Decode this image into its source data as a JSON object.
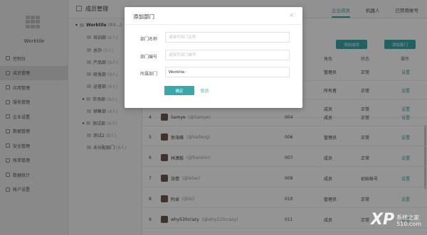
{
  "app": {
    "brand": "Worktile",
    "header_title": "成员管理",
    "tabs": [
      "企业成员",
      "机器人",
      "已禁用帐号"
    ]
  },
  "sidebar": {
    "items": [
      {
        "label": "控制台",
        "icon": "dashboard-icon"
      },
      {
        "label": "成员管理",
        "icon": "members-icon",
        "active": true
      },
      {
        "label": "应用管理",
        "icon": "apps-icon"
      },
      {
        "label": "服务管理",
        "icon": "service-icon"
      },
      {
        "label": "企业设置",
        "icon": "settings-icon"
      },
      {
        "label": "数据管理",
        "icon": "data-icon"
      },
      {
        "label": "安全管理",
        "icon": "security-icon"
      },
      {
        "label": "账单管理",
        "icon": "billing-icon"
      },
      {
        "label": "数据统计",
        "icon": "stats-icon"
      },
      {
        "label": "帐户设置",
        "icon": "account-icon"
      }
    ]
  },
  "tree": {
    "root": {
      "label": "Worktile",
      "count": "(83…)"
    },
    "items": [
      {
        "label": "培训部",
        "count": "(6人)"
      },
      {
        "label": "总办",
        "count": "(5人)"
      },
      {
        "label": "产品部",
        "count": "(9人)"
      },
      {
        "label": "研发部",
        "count": "(9人)"
      },
      {
        "label": "运营部",
        "count": "(6人)"
      },
      {
        "label": "市场部",
        "count": "(9人)"
      },
      {
        "label": "销售部",
        "count": "(4人)"
      },
      {
        "label": "测试部",
        "count": "(6人)"
      },
      {
        "label": "测试2",
        "count": "(8人)"
      },
      {
        "label": "未分配部门",
        "count": "(8人)"
      }
    ]
  },
  "toolbar": {
    "add_member": "添加成员",
    "add_dept": "添加部门"
  },
  "table": {
    "headers": {
      "role": "角色",
      "status": "状态",
      "action": "操作"
    },
    "top_rows": [
      {
        "role": "管理员",
        "status": "正常",
        "action": "设置"
      },
      {
        "role": "所有者",
        "status": "正常",
        "action": "设置"
      },
      {
        "role": "成员",
        "status": "正常",
        "action": "设置"
      }
    ],
    "rows": [
      {
        "no": "4",
        "name": "Samye",
        "handle": "(@Samye)",
        "code": "004",
        "role": "成员",
        "status": "正常",
        "action": "设置"
      },
      {
        "no": "5",
        "name": "徐海峰",
        "handle": "(@haifeng)",
        "code": "006",
        "role": "管理员",
        "status": "正常",
        "action": "设置"
      },
      {
        "no": "6",
        "name": "林潇毅",
        "handle": "(@franklin)",
        "code": "007",
        "role": "成员",
        "status": "正常",
        "action": "设置"
      },
      {
        "no": "7",
        "name": "张倩",
        "handle": "(@lelao)",
        "code": "009",
        "role": "成员",
        "status": "初始帐号",
        "action": "设置"
      },
      {
        "no": "8",
        "name": "阿卓",
        "handle": "(@liz)",
        "code": "010",
        "role": "管理员",
        "status": "正常",
        "action": "设置"
      },
      {
        "no": "9",
        "name": "why520crazy",
        "handle": "(@why520crazy)",
        "code": "011",
        "role": "成员",
        "status": "正常",
        "action": "设置"
      }
    ]
  },
  "modal": {
    "title": "添加部门",
    "close": "×",
    "fields": [
      {
        "label": "部门名称",
        "placeholder": "请填写部门名称",
        "value": ""
      },
      {
        "label": "部门编号",
        "placeholder": "请填写部门编号",
        "value": ""
      },
      {
        "label": "所属部门",
        "placeholder": "",
        "value": "Worktile"
      }
    ],
    "confirm": "确定",
    "cancel": "取消"
  },
  "watermark": {
    "logo": "XP",
    "line1": "系统之家",
    "line2": "510.com"
  },
  "colors": {
    "accent": "#3aa8a8",
    "overlay": "rgba(0,0,0,0.42)"
  }
}
